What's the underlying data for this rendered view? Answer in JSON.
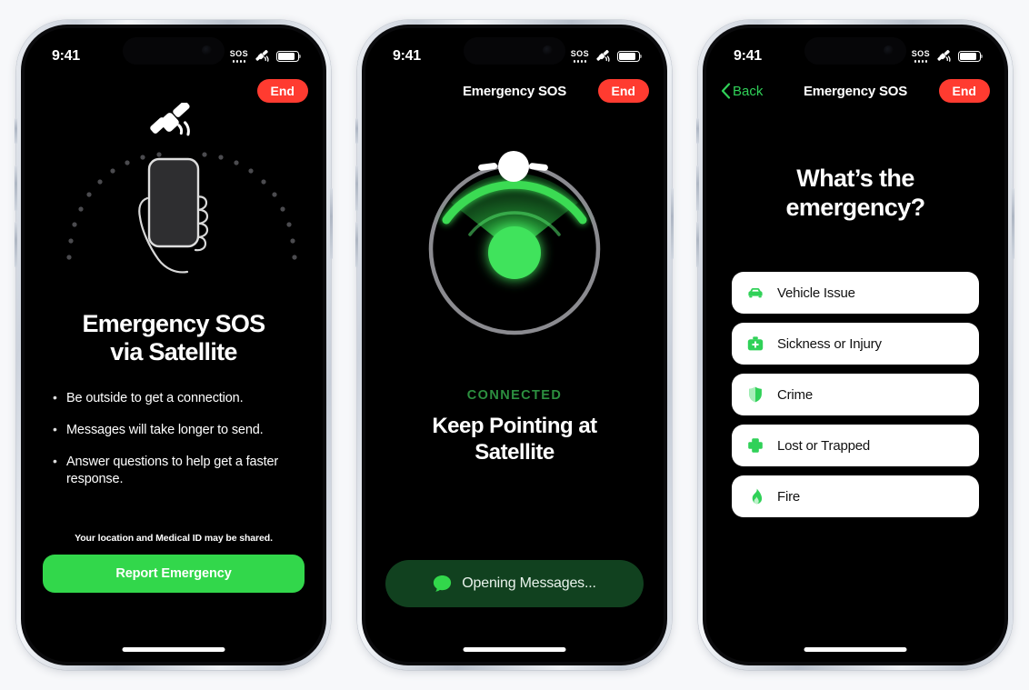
{
  "theme": {
    "page_background": "#f7f8fa",
    "accent_green": "#30d158",
    "report_button_green": "#32d74b",
    "end_button_red": "#ff3b30",
    "connected_green": "#2c8f3f",
    "opening_button_green": "#11411f",
    "screen_black": "#000000"
  },
  "statusbar": {
    "time": "9:41",
    "sos_label": "SOS",
    "icons": [
      "sos-indicator-icon",
      "satellite-icon",
      "battery-icon"
    ]
  },
  "phones": [
    {
      "id": "phone-onboarding",
      "navbar": {
        "title": "",
        "end_label": "End",
        "back_label": ""
      },
      "illustration": {
        "satellite_icon": "satellite-icon",
        "hand_phone_icon": "hand-holding-phone-icon",
        "arc_dots": 21
      },
      "title_line1": "Emergency SOS",
      "title_line2": "via Satellite",
      "bullets": [
        "Be outside to get a connection.",
        "Messages will take longer to send.",
        "Answer questions to help get a faster response."
      ],
      "disclaimer": "Your location and Medical ID may be shared.",
      "primary_button": "Report Emergency"
    },
    {
      "id": "phone-pointing",
      "navbar": {
        "title": "Emergency SOS",
        "end_label": "End",
        "back_label": ""
      },
      "dial": {
        "satellite_marker_icon": "satellite-marker-icon",
        "cone_direction_degrees": 0,
        "cone_width_degrees": 80
      },
      "status_label": "CONNECTED",
      "headline_line1": "Keep Pointing at",
      "headline_line2": "Satellite",
      "action_button": {
        "icon": "message-bubble-icon",
        "label": "Opening Messages..."
      }
    },
    {
      "id": "phone-questions",
      "navbar": {
        "title": "Emergency SOS",
        "end_label": "End",
        "back_label": "Back"
      },
      "question_line1": "What’s the",
      "question_line2": "emergency?",
      "options": [
        {
          "label": "Vehicle Issue",
          "icon": "car-icon"
        },
        {
          "label": "Sickness or Injury",
          "icon": "medical-kit-icon"
        },
        {
          "label": "Crime",
          "icon": "shield-icon"
        },
        {
          "label": "Lost or Trapped",
          "icon": "medical-cross-icon"
        },
        {
          "label": "Fire",
          "icon": "flame-icon"
        }
      ]
    }
  ]
}
